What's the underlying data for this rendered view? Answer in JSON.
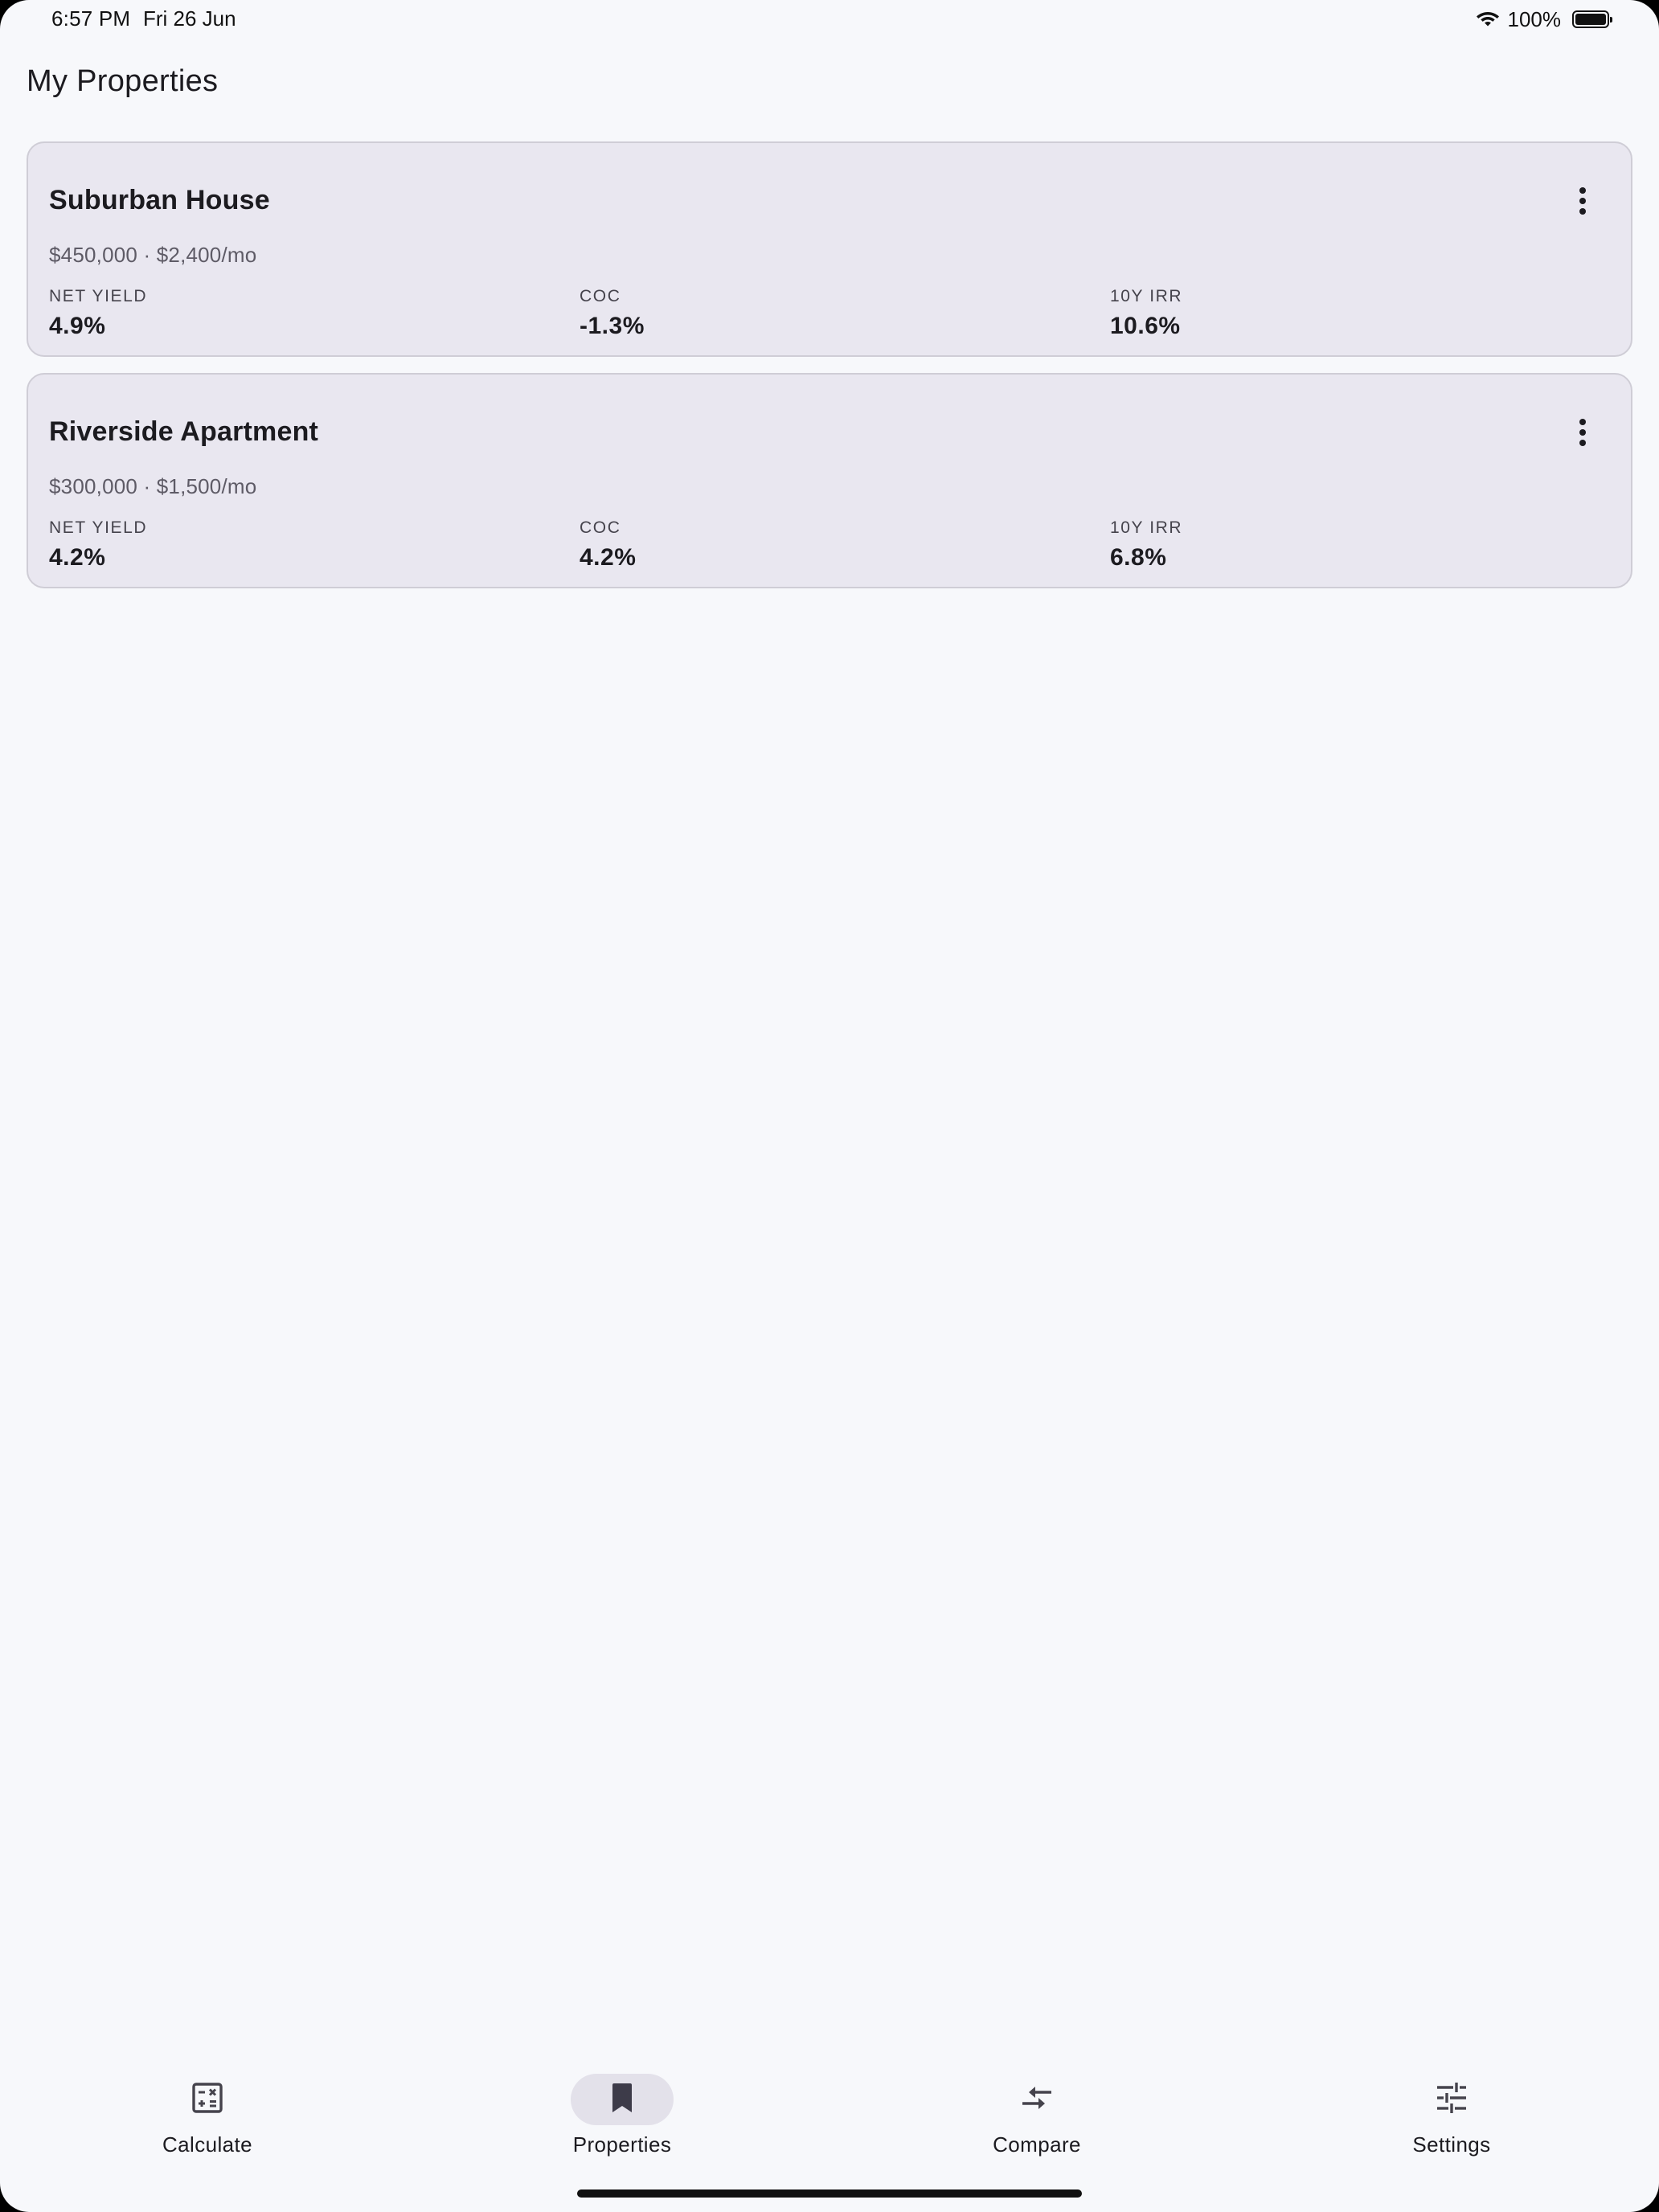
{
  "status_bar": {
    "time": "6:57 PM",
    "date": "Fri 26 Jun",
    "battery_percent": "100%",
    "icons": [
      "wifi-icon",
      "battery-icon"
    ]
  },
  "header": {
    "title": "My Properties"
  },
  "properties": [
    {
      "name": "Suburban House",
      "summary": "$450,000 · $2,400/mo",
      "metrics": [
        {
          "label": "NET YIELD",
          "value": "4.9%"
        },
        {
          "label": "COC",
          "value": "-1.3%"
        },
        {
          "label": "10Y IRR",
          "value": "10.6%"
        }
      ],
      "menu_icon": "more-vert-icon"
    },
    {
      "name": "Riverside Apartment",
      "summary": "$300,000 · $1,500/mo",
      "metrics": [
        {
          "label": "NET YIELD",
          "value": "4.2%"
        },
        {
          "label": "COC",
          "value": "4.2%"
        },
        {
          "label": "10Y IRR",
          "value": "6.8%"
        }
      ],
      "menu_icon": "more-vert-icon"
    }
  ],
  "bottom_nav": {
    "active": "Properties",
    "items": [
      {
        "label": "Calculate",
        "icon": "calculator-icon"
      },
      {
        "label": "Properties",
        "icon": "bookmark-icon"
      },
      {
        "label": "Compare",
        "icon": "compare-arrows-icon"
      },
      {
        "label": "Settings",
        "icon": "tune-icon"
      }
    ]
  },
  "colors": {
    "background": "#f7f8fb",
    "card": "#e9e7f0",
    "card_border": "#cfcdd6",
    "text_primary": "#1c1b20",
    "text_secondary": "#5e5b66",
    "nav_active_pill": "#e3e1ea"
  }
}
